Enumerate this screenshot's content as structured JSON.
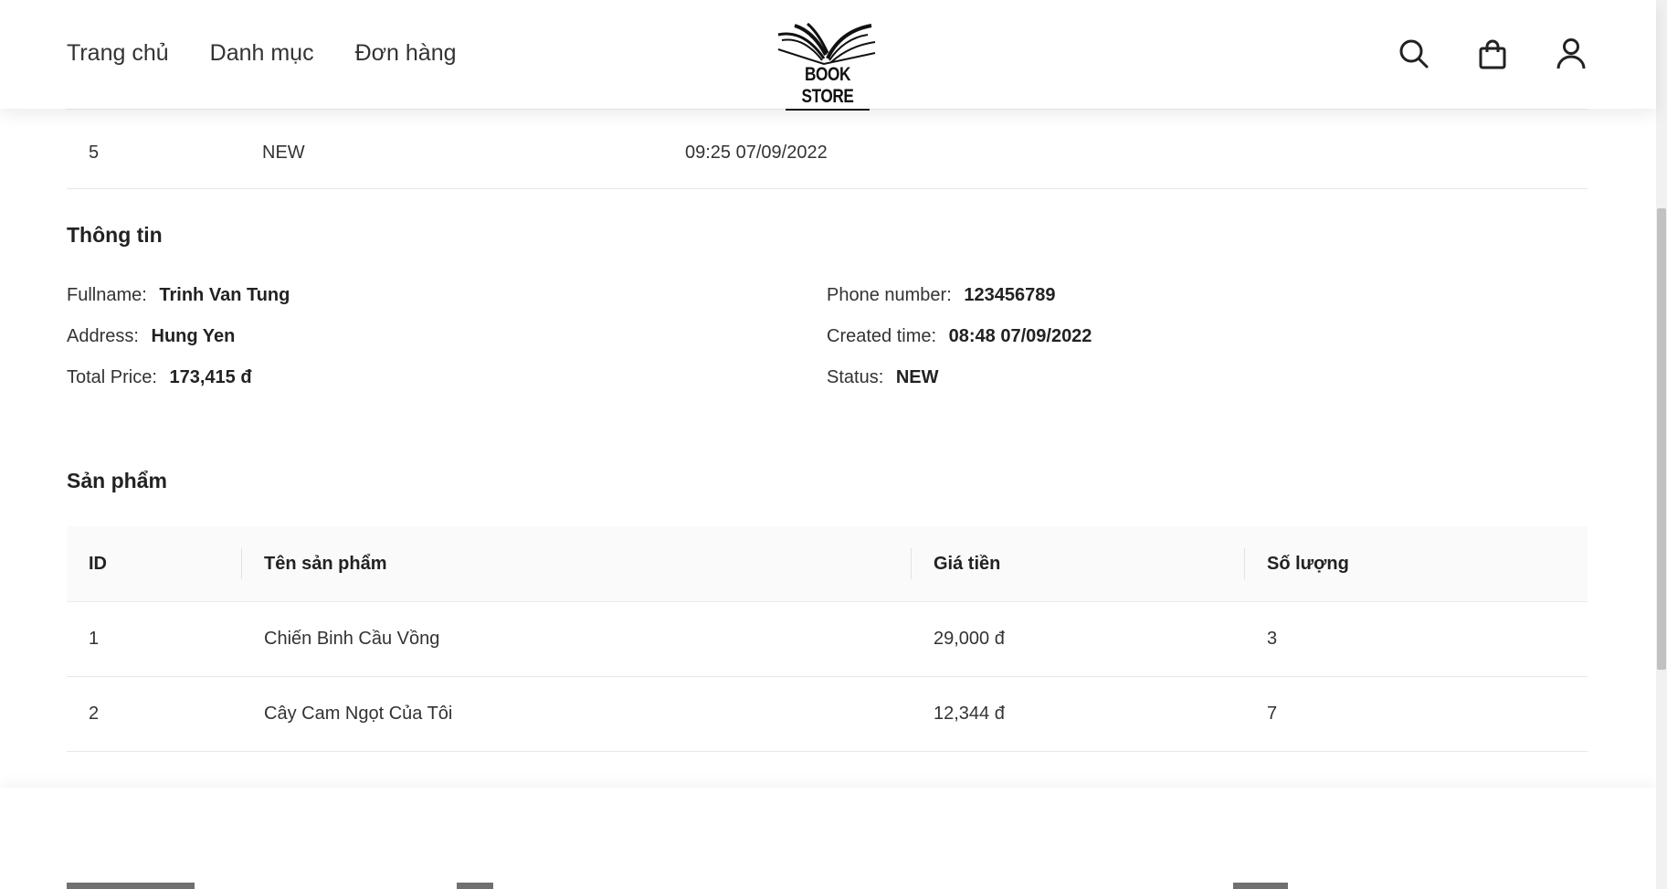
{
  "nav": {
    "home": "Trang chủ",
    "categories": "Danh mục",
    "orders": "Đơn hàng"
  },
  "logo": {
    "text": "BOOK STORE"
  },
  "icons": {
    "search": "search-icon",
    "cart": "shopping-bag-icon",
    "account": "user-icon"
  },
  "history_row": {
    "id": "5",
    "status": "NEW",
    "time": "09:25 07/09/2022"
  },
  "info": {
    "title": "Thông tin",
    "fullname_label": "Fullname",
    "fullname": "Trinh Van Tung",
    "address_label": "Address",
    "address": "Hung Yen",
    "total_label": "Total Price",
    "total": "173,415 đ",
    "phone_label": "Phone number",
    "phone": "123456789",
    "created_label": "Created time",
    "created": "08:48 07/09/2022",
    "status_label": "Status",
    "status": "NEW"
  },
  "products": {
    "title": "Sản phẩm",
    "headers": [
      "ID",
      "Tên sản phẩm",
      "Giá tiền",
      "Số lượng"
    ],
    "rows": [
      {
        "id": "1",
        "name": "Chiến Binh Cầu Vồng",
        "price": "29,000 đ",
        "qty": "3"
      },
      {
        "id": "2",
        "name": "Cây Cam Ngọt Của Tôi",
        "price": "12,344 đ",
        "qty": "7"
      }
    ]
  },
  "colors": {
    "text": "#222222",
    "header_bg": "#ffffff",
    "table_head_bg": "#fafafa",
    "border": "#e8e8e8"
  }
}
